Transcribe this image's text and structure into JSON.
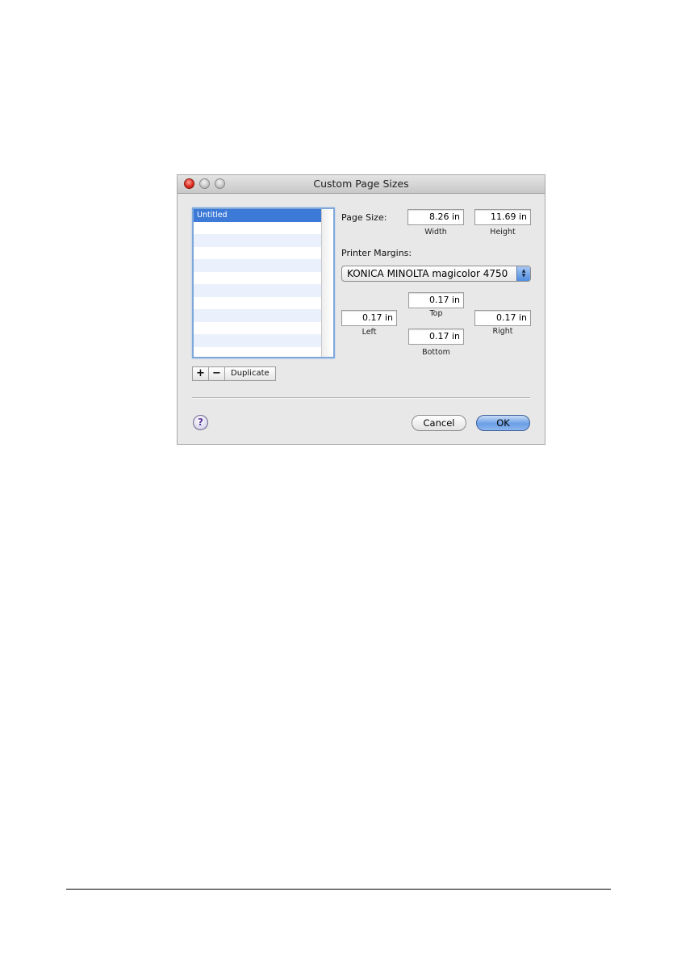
{
  "window": {
    "title": "Custom Page Sizes"
  },
  "sizes_list": {
    "items": [
      {
        "label": "Untitled",
        "selected": true
      }
    ],
    "add_label": "+",
    "remove_label": "−",
    "duplicate_label": "Duplicate"
  },
  "page_size": {
    "label": "Page Size:",
    "width_value": "8.26 in",
    "width_label": "Width",
    "height_value": "11.69 in",
    "height_label": "Height"
  },
  "printer_margins": {
    "label": "Printer Margins:",
    "printer": "KONICA MINOLTA magicolor 4750",
    "top_value": "0.17 in",
    "top_label": "Top",
    "left_value": "0.17 in",
    "left_label": "Left",
    "right_value": "0.17 in",
    "right_label": "Right",
    "bottom_value": "0.17 in",
    "bottom_label": "Bottom"
  },
  "footer": {
    "help_label": "?",
    "cancel_label": "Cancel",
    "ok_label": "OK"
  },
  "colors": {
    "selection": "#3d7ad8",
    "stripe": "#eaf1fc",
    "close_button": "#d8261a",
    "default_button": "#6a9ee6"
  }
}
